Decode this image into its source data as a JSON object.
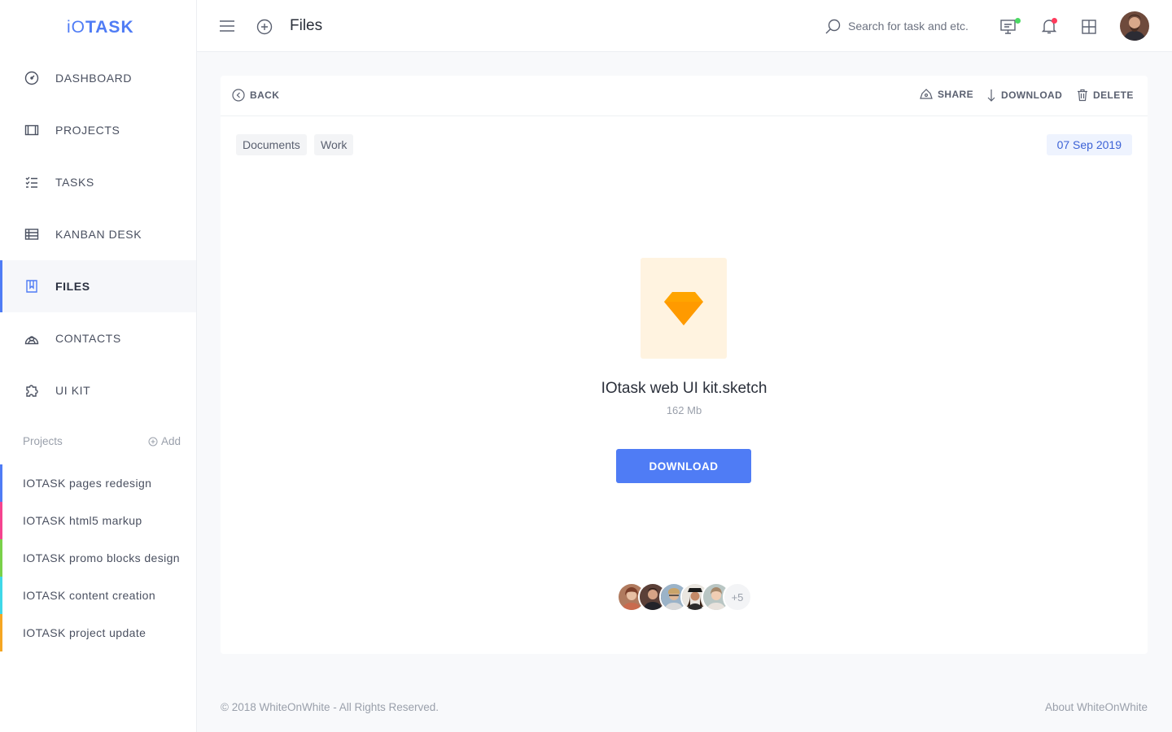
{
  "app": {
    "logo_prefix": "iO",
    "logo_suffix": "TASK",
    "accent_color": "#4f7cf5"
  },
  "sidebar": {
    "items": [
      {
        "label": "DASHBOARD",
        "icon": "dashboard-gauge-icon"
      },
      {
        "label": "PROJECTS",
        "icon": "projects-icon"
      },
      {
        "label": "TASKS",
        "icon": "tasks-checklist-icon"
      },
      {
        "label": "KANBAN DESK",
        "icon": "kanban-table-icon"
      },
      {
        "label": "FILES",
        "icon": "files-icon",
        "active": true
      },
      {
        "label": "CONTACTS",
        "icon": "contacts-icon"
      },
      {
        "label": "UI KIT",
        "icon": "puzzle-icon"
      }
    ],
    "projects_heading": "Projects",
    "add_label": "Add",
    "projects": [
      {
        "label": "IOTASK pages redesign",
        "color": "#4f7cf5"
      },
      {
        "label": "IOTASK html5 markup",
        "color": "#f5438f"
      },
      {
        "label": "IOTASK promo blocks design",
        "color": "#7ad14a"
      },
      {
        "label": "IOTASK content creation",
        "color": "#3fd8e8"
      },
      {
        "label": "IOTASK project update",
        "color": "#f5a623"
      }
    ]
  },
  "header": {
    "title": "Files",
    "search_placeholder": "Search for task and etc.",
    "messages_dot_color": "#4cd964",
    "notifications_dot_color": "#ff3b5c"
  },
  "toolbar": {
    "back_label": "BACK",
    "share_label": "SHARE",
    "download_label": "DOWNLOAD",
    "delete_label": "DELETE"
  },
  "file": {
    "tags": [
      "Documents",
      "Work"
    ],
    "date": "07 Sep 2019",
    "name": "IOtask web UI kit.sketch",
    "size": "162 Mb",
    "download_button": "DOWNLOAD",
    "icon": "sketch-diamond-icon",
    "members_more": "+5"
  },
  "footer": {
    "copyright": "© 2018 WhiteOnWhite - All Rights Reserved.",
    "about_link": "About WhiteOnWhite"
  }
}
